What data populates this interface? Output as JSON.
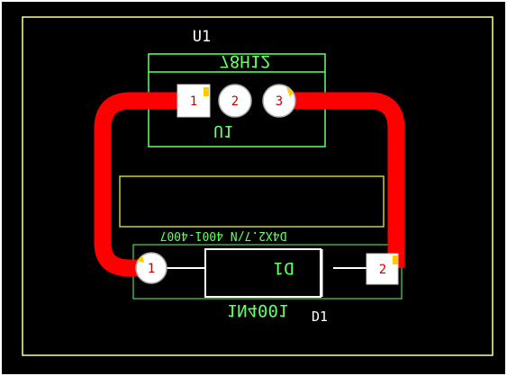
{
  "colors": {
    "canvas_bg": "#000000",
    "page_border": "#ffffff",
    "board_outline": "#ffff99",
    "silkscreen_green": "#66ff66",
    "trace": "#ff0000",
    "pad_fill": "#ffffff",
    "pad_number": "#cc0000",
    "pad_accent": "#ffcc00",
    "label_white": "#ffffff",
    "keepout_yellow": "#cccc33"
  },
  "components": {
    "u1": {
      "designator_top": "U1",
      "value_mirrored": "78H12",
      "designator_mirrored": "U1",
      "pads": [
        "1",
        "2",
        "3"
      ]
    },
    "d1": {
      "footprint_mirrored": "D4X2.7/N 4001-4007",
      "designator_mirrored": "D1",
      "value_mirrored": "1N4001",
      "designator_bottom": "D1",
      "pads": [
        "1",
        "2"
      ]
    }
  }
}
